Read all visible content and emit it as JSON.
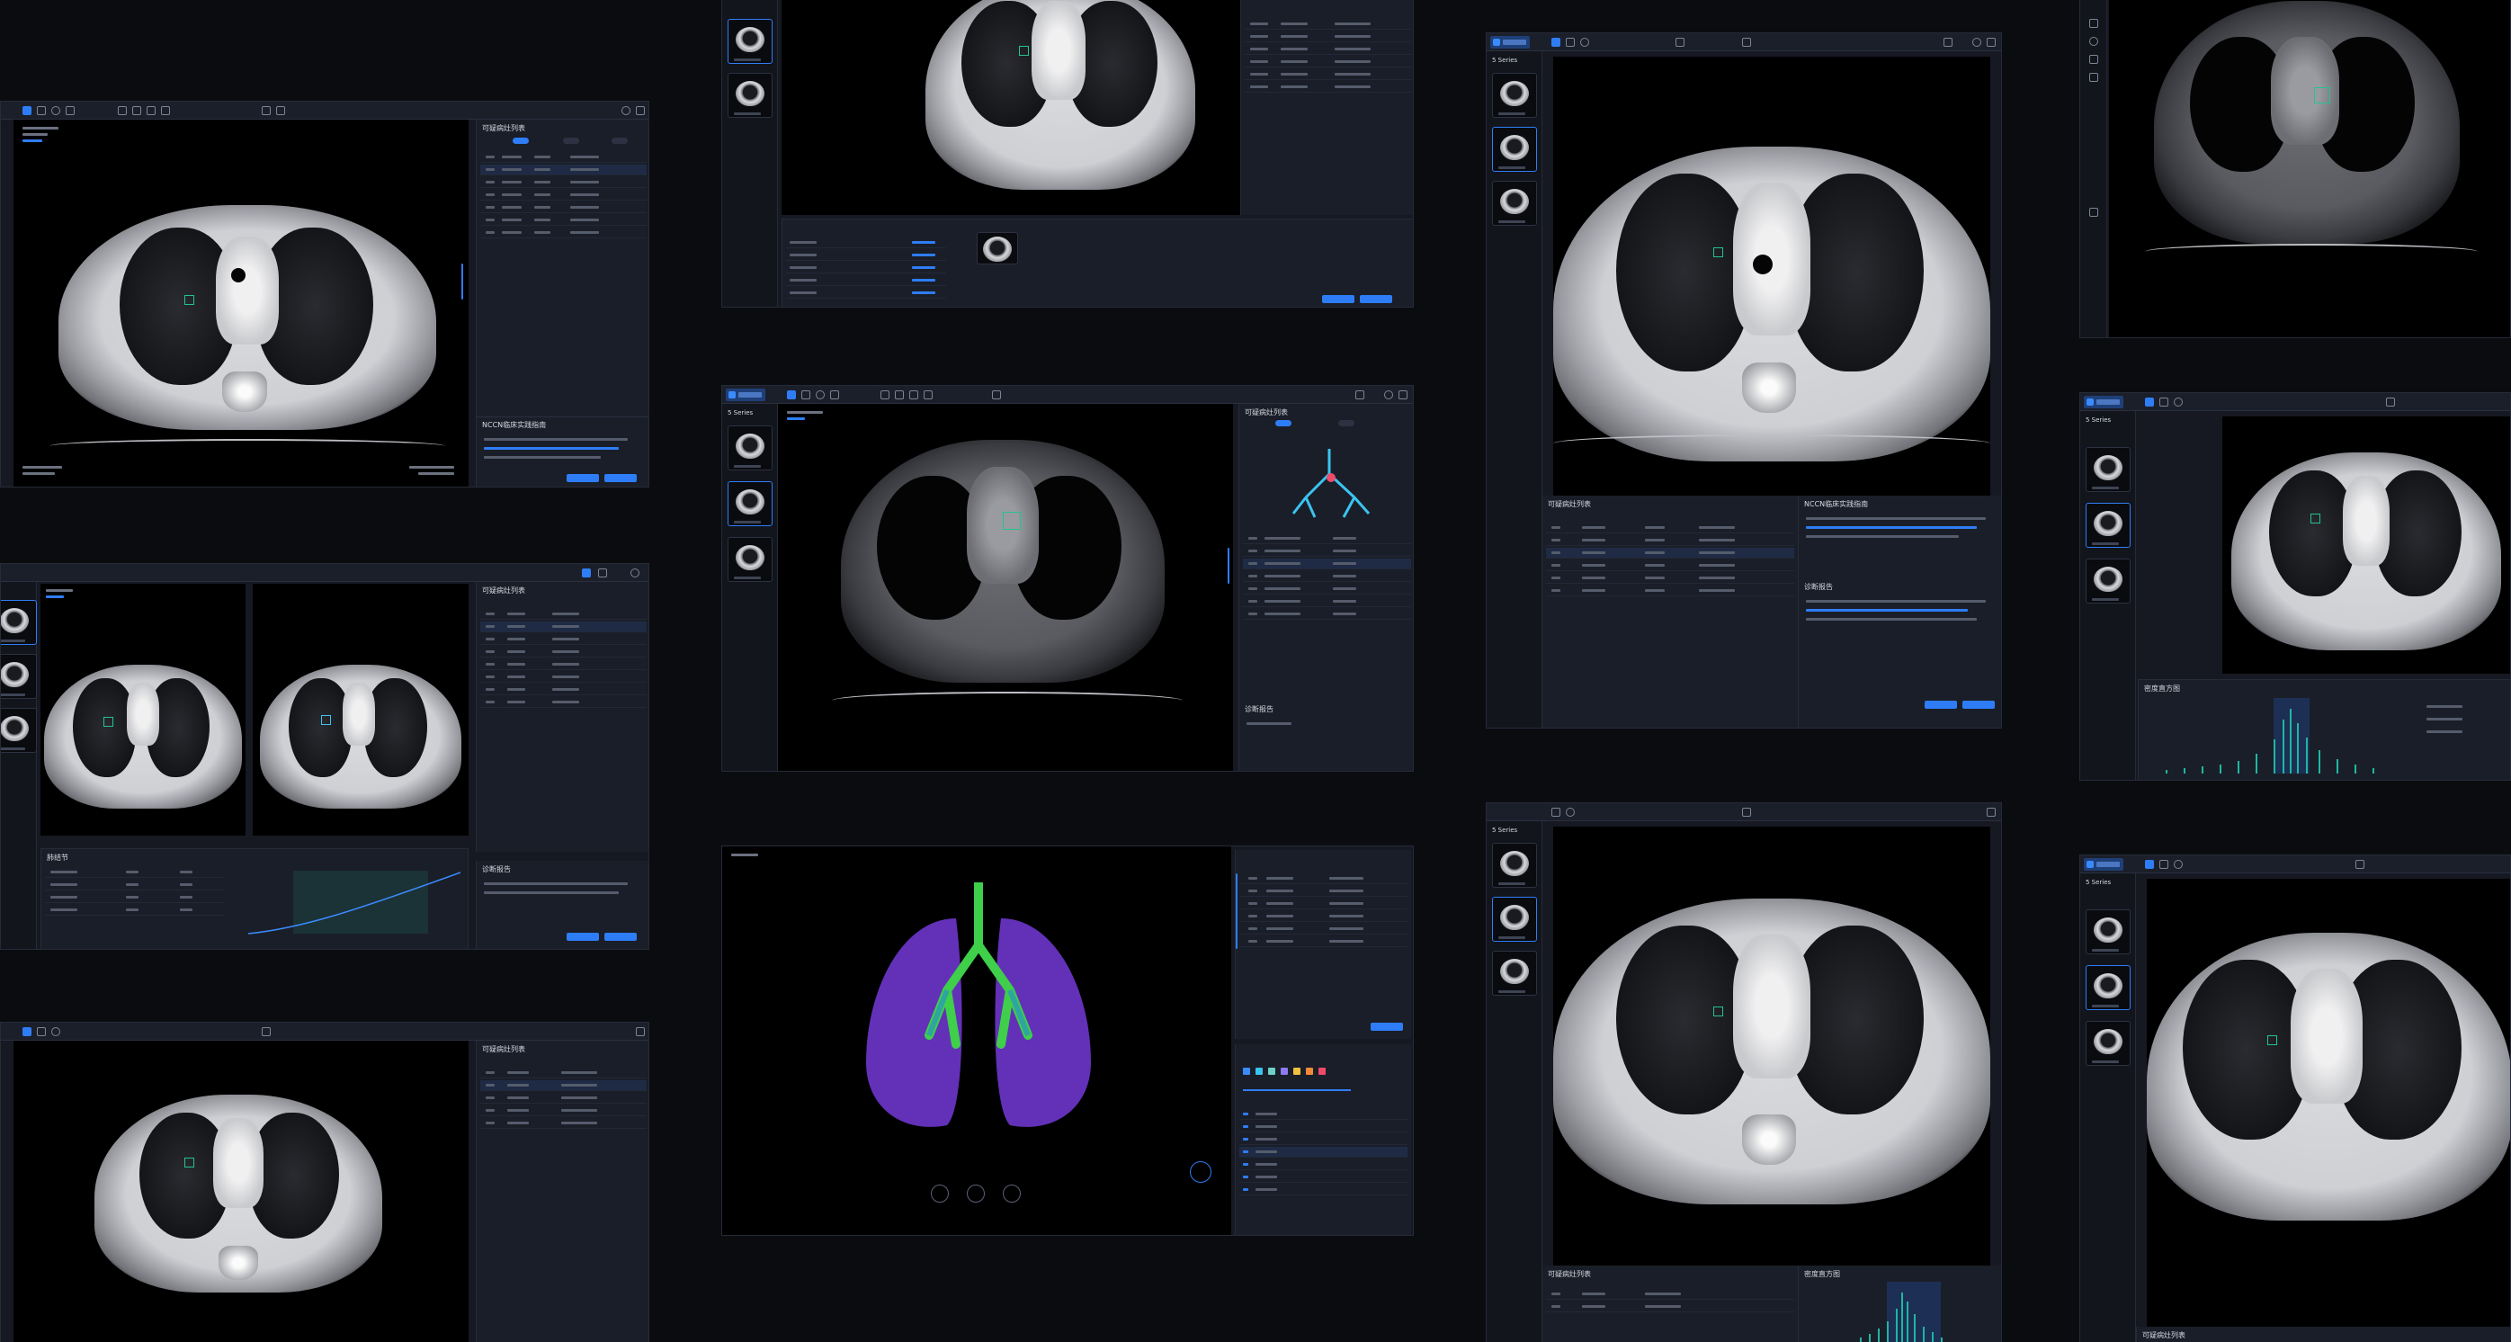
{
  "panels": {
    "nodule_list_title": "可疑病灶列表",
    "nccn_title": "NCCN临床实践指南",
    "report_title": "诊断报告",
    "histogram_title": "密度直方图",
    "series_count": "5 Series",
    "nodule_label": "肺结节"
  },
  "colors": {
    "accent": "#2f7df6",
    "roi": "#23c48d",
    "histogram": "#1fb7a0",
    "lung_render": "#7a3fd6",
    "airway_render": "#3fcf4a"
  },
  "icons": [
    "layout-icon",
    "pan-icon",
    "zoom-icon",
    "window-level-icon",
    "measure-icon",
    "rotate-icon",
    "reset-icon",
    "play-icon",
    "undo-icon",
    "settings-icon",
    "help-icon",
    "trash-icon"
  ],
  "color_swatches": [
    "#3b8bff",
    "#3bc4f0",
    "#6fd0c8",
    "#8a7cf0",
    "#f0c040",
    "#f08a3b",
    "#f04a6a"
  ]
}
